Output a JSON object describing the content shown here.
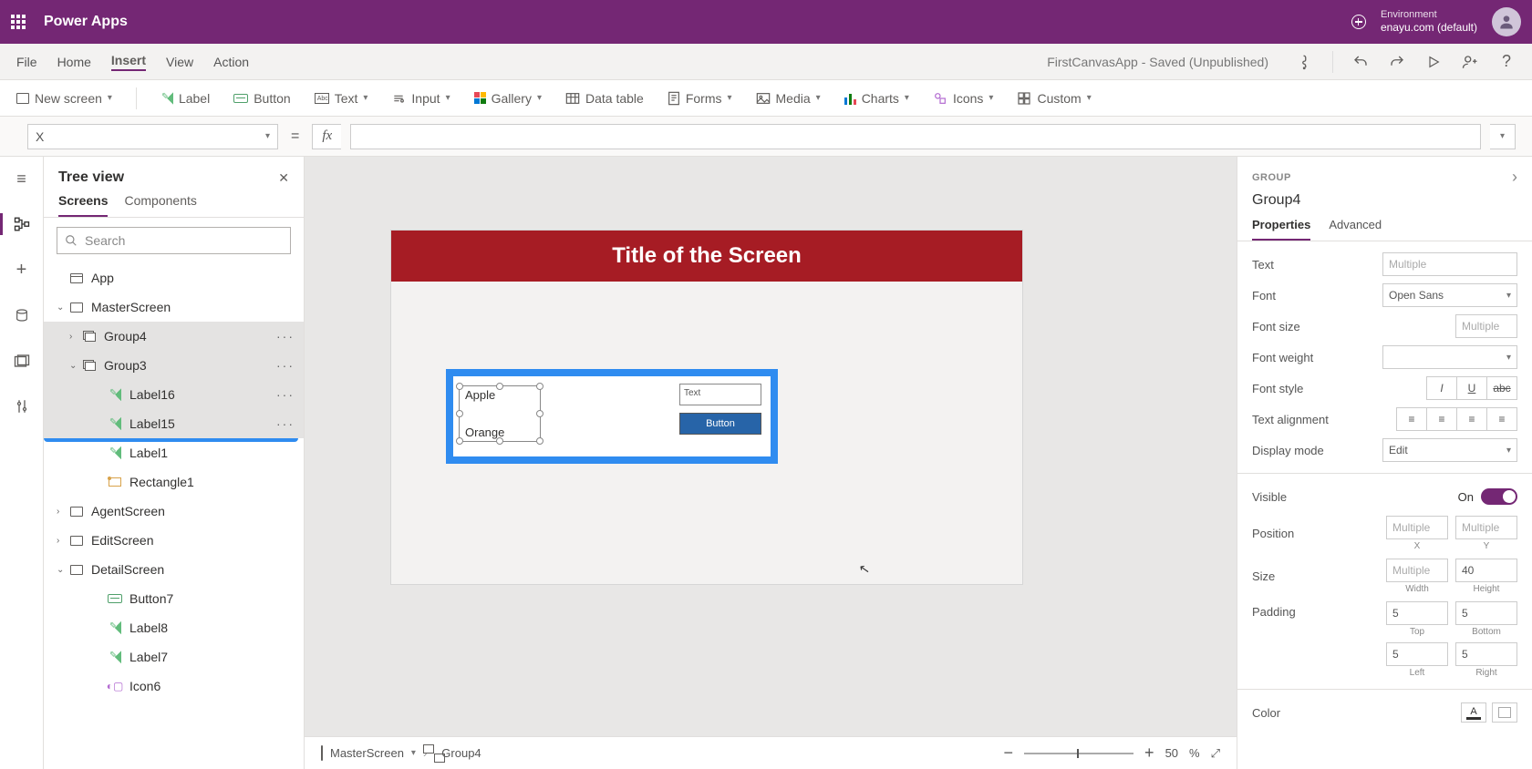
{
  "header": {
    "app_name": "Power Apps",
    "env_label": "Environment",
    "env_value": "enayu.com (default)"
  },
  "menu": {
    "items": [
      "File",
      "Home",
      "Insert",
      "View",
      "Action"
    ],
    "active_index": 2,
    "doc_title": "FirstCanvasApp - Saved (Unpublished)"
  },
  "ribbon": {
    "new_screen": "New screen",
    "label": "Label",
    "button": "Button",
    "text": "Text",
    "input": "Input",
    "gallery": "Gallery",
    "data_table": "Data table",
    "forms": "Forms",
    "media": "Media",
    "charts": "Charts",
    "icons": "Icons",
    "custom": "Custom"
  },
  "formula": {
    "property": "X",
    "fx": "fx"
  },
  "tree": {
    "title": "Tree view",
    "tabs": [
      "Screens",
      "Components"
    ],
    "search_placeholder": "Search",
    "items": [
      {
        "label": "App",
        "type": "app",
        "indent": 0
      },
      {
        "label": "MasterScreen",
        "type": "screen",
        "indent": 0,
        "expander": "v"
      },
      {
        "label": "Group4",
        "type": "group",
        "indent": 1,
        "expander": ">",
        "dots": true
      },
      {
        "label": "Group3",
        "type": "group",
        "indent": 1,
        "expander": "v",
        "dots": true
      },
      {
        "label": "Label16",
        "type": "label",
        "indent": 2,
        "dots": true
      },
      {
        "label": "Label15",
        "type": "label",
        "indent": 2,
        "dots": true
      },
      {
        "label": "Label1",
        "type": "label",
        "indent": 2
      },
      {
        "label": "Rectangle1",
        "type": "rect",
        "indent": 2
      },
      {
        "label": "AgentScreen",
        "type": "screen",
        "indent": 0,
        "expander": ">"
      },
      {
        "label": "EditScreen",
        "type": "screen",
        "indent": 0,
        "expander": ">"
      },
      {
        "label": "DetailScreen",
        "type": "screen",
        "indent": 0,
        "expander": "v"
      },
      {
        "label": "Button7",
        "type": "button",
        "indent": 2
      },
      {
        "label": "Label8",
        "type": "label",
        "indent": 2
      },
      {
        "label": "Label7",
        "type": "label",
        "indent": 2
      },
      {
        "label": "Icon6",
        "type": "icon",
        "indent": 2
      }
    ]
  },
  "canvas": {
    "screen_title": "Title of the Screen",
    "apple": "Apple",
    "orange": "Orange",
    "text_placeholder": "Text",
    "button_text": "Button"
  },
  "breadcrumb": {
    "screen": "MasterScreen",
    "selection": "Group4"
  },
  "zoom": {
    "value": "50",
    "pct": "%"
  },
  "props": {
    "category": "GROUP",
    "name": "Group4",
    "tabs": [
      "Properties",
      "Advanced"
    ],
    "text": "Text",
    "text_value": "Multiple",
    "font": "Font",
    "font_value": "Open Sans",
    "font_size": "Font size",
    "font_size_value": "Multiple",
    "font_weight": "Font weight",
    "font_style": "Font style",
    "text_align": "Text alignment",
    "display_mode": "Display mode",
    "display_mode_value": "Edit",
    "visible": "Visible",
    "visible_value": "On",
    "position": "Position",
    "pos_x": "Multiple",
    "pos_y": "Multiple",
    "pos_x_label": "X",
    "pos_y_label": "Y",
    "size": "Size",
    "size_w": "Multiple",
    "size_h": "40",
    "size_w_label": "Width",
    "size_h_label": "Height",
    "padding": "Padding",
    "pad_t": "5",
    "pad_b": "5",
    "pad_l": "5",
    "pad_r": "5",
    "pad_t_label": "Top",
    "pad_b_label": "Bottom",
    "pad_l_label": "Left",
    "pad_r_label": "Right",
    "color": "Color"
  }
}
